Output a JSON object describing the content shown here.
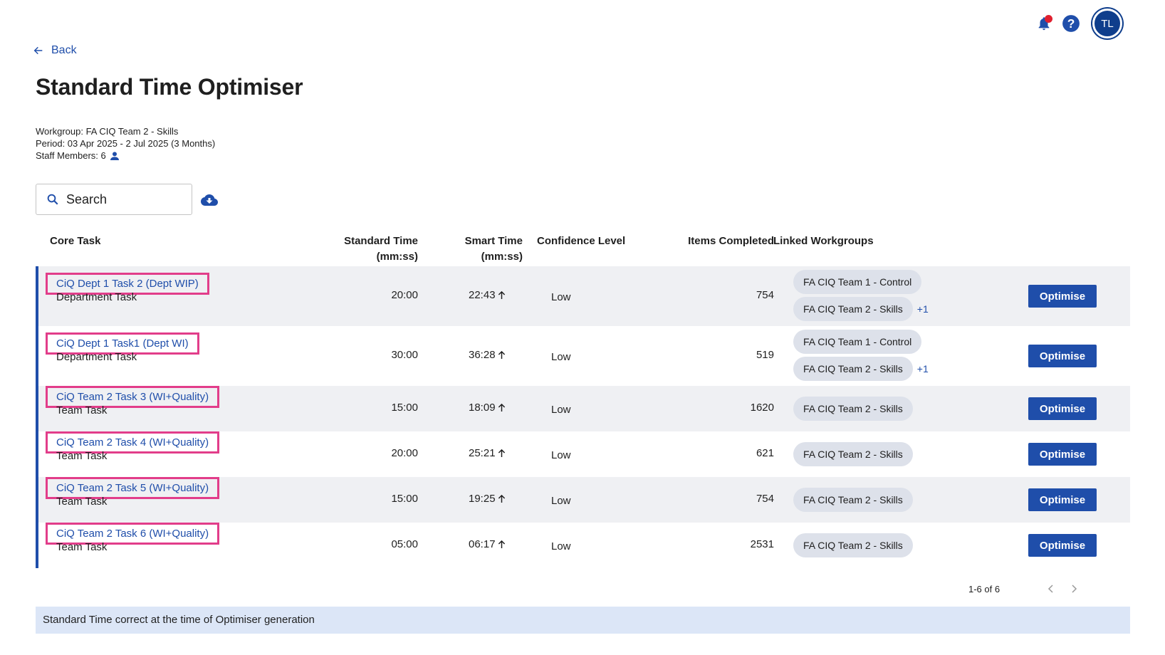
{
  "header": {
    "notification_icon": "bell-icon",
    "help_icon": "question-circle-icon",
    "avatar_initials": "TL",
    "brand_color": "#1f4eaa",
    "alert_color": "#e0202f"
  },
  "back_label": "Back",
  "page_title": "Standard Time Optimiser",
  "meta": {
    "workgroup": "Workgroup: FA CIQ Team 2 - Skills",
    "period": "Period: 03 Apr 2025 - 2 Jul 2025 (3 Months)",
    "staff_members": "Staff Members: 6"
  },
  "search": {
    "placeholder": "Search"
  },
  "table": {
    "headers": {
      "core_task": "Core Task",
      "standard_time": "Standard Time",
      "standard_time_unit": "(mm:ss)",
      "smart_time": "Smart Time",
      "smart_time_unit": "(mm:ss)",
      "confidence": "Confidence Level",
      "items_completed": "Items Completed",
      "linked_workgroups": "Linked Workgroups"
    },
    "rows": [
      {
        "task": "CiQ Dept 1 Task 2 (Dept WIP)",
        "type": "Department Task",
        "standard": "20:00",
        "smart": "22:43",
        "confidence": "Low",
        "items": "754",
        "workgroups": [
          "FA CIQ Team 1 - Control",
          "FA CIQ Team 2 - Skills"
        ],
        "extra": "+1",
        "action": "Optimise"
      },
      {
        "task": "CiQ Dept 1 Task1 (Dept WI)",
        "type": "Department Task",
        "standard": "30:00",
        "smart": "36:28",
        "confidence": "Low",
        "items": "519",
        "workgroups": [
          "FA CIQ Team 1 - Control",
          "FA CIQ Team 2 - Skills"
        ],
        "extra": "+1",
        "action": "Optimise"
      },
      {
        "task": "CiQ Team 2 Task 3 (WI+Quality)",
        "type": "Team Task",
        "standard": "15:00",
        "smart": "18:09",
        "confidence": "Low",
        "items": "1620",
        "workgroups": [
          "FA CIQ Team 2 - Skills"
        ],
        "action": "Optimise"
      },
      {
        "task": "CiQ Team 2 Task 4 (WI+Quality)",
        "type": "Team Task",
        "standard": "20:00",
        "smart": "25:21",
        "confidence": "Low",
        "items": "621",
        "workgroups": [
          "FA CIQ Team 2 - Skills"
        ],
        "action": "Optimise"
      },
      {
        "task": "CiQ Team 2 Task 5 (WI+Quality)",
        "type": "Team Task",
        "standard": "15:00",
        "smart": "19:25",
        "confidence": "Low",
        "items": "754",
        "workgroups": [
          "FA CIQ Team 2 - Skills"
        ],
        "action": "Optimise"
      },
      {
        "task": "CiQ Team 2 Task 6 (WI+Quality)",
        "type": "Team Task",
        "standard": "05:00",
        "smart": "06:17",
        "confidence": "Low",
        "items": "2531",
        "workgroups": [
          "FA CIQ Team 2 - Skills"
        ],
        "action": "Optimise"
      }
    ]
  },
  "pagination": {
    "range": "1-6 of 6"
  },
  "footer_note": "Standard Time correct at the time of Optimiser generation"
}
